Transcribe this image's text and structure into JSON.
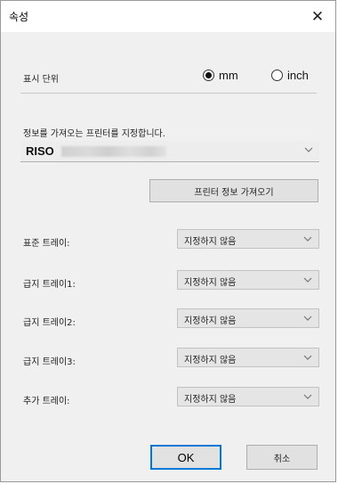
{
  "dialog": {
    "title": "속성"
  },
  "units": {
    "label": "표시 단위",
    "options": [
      {
        "label": "mm",
        "checked": true
      },
      {
        "label": "inch",
        "checked": false
      }
    ]
  },
  "printer": {
    "label": "정보를 가져오는 프린터를 지정합니다.",
    "selected": "RISO",
    "get_info_button": "프린터 정보 가져오기"
  },
  "trays": [
    {
      "label": "표준 트레이:",
      "value": "지정하지 않음"
    },
    {
      "label": "급지 트레이1:",
      "value": "지정하지 않음"
    },
    {
      "label": "급지 트레이2:",
      "value": "지정하지 않음"
    },
    {
      "label": "급지 트레이3:",
      "value": "지정하지 않음"
    },
    {
      "label": "추가 트레이:",
      "value": "지정하지 않음"
    }
  ],
  "buttons": {
    "ok": "OK",
    "cancel": "취소"
  },
  "icons": {
    "close": "close-icon",
    "dropdown": "chevron-down-icon"
  }
}
